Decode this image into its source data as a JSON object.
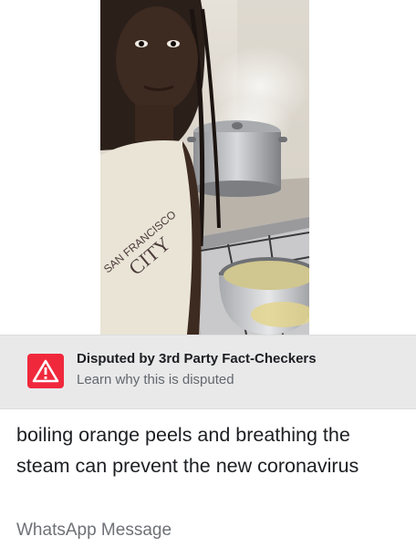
{
  "video": {
    "shirt_print_line1": "SAN FRANCISCO",
    "shirt_print_line2": "CITY"
  },
  "fact_check": {
    "icon": "alert-triangle-icon",
    "icon_color": "#f0283c",
    "title": "Disputed by 3rd Party Fact-Checkers",
    "link": "Learn why this is disputed"
  },
  "post": {
    "caption": "boiling orange peels and breathing the steam can prevent the new coronavirus",
    "source": "WhatsApp Message"
  }
}
